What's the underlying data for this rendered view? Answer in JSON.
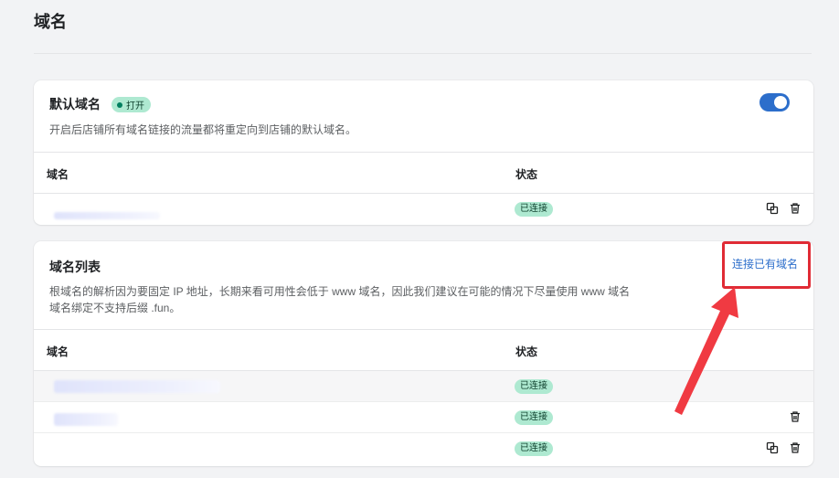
{
  "page": {
    "title": "域名"
  },
  "default_domain": {
    "title": "默认域名",
    "badge": "打开",
    "description": "开启后店铺所有域名链接的流量都将重定向到店铺的默认域名。",
    "toggle_on": true,
    "columns": [
      "域名",
      "状态"
    ],
    "rows": [
      {
        "status": "已连接",
        "actions": [
          "copy-icon",
          "delete-icon"
        ]
      }
    ]
  },
  "domain_list": {
    "title": "域名列表",
    "connect_link": "连接已有域名",
    "description_line1": "根域名的解析因为要固定 IP 地址，长期来看可用性会低于 www 域名，因此我们建议在可能的情况下尽量使用 www 域名",
    "description_line2": "域名绑定不支持后缀 .fun。",
    "columns": [
      "域名",
      "状态"
    ],
    "rows": [
      {
        "status": "已连接",
        "actions": []
      },
      {
        "status": "已连接",
        "actions": [
          "delete-icon"
        ]
      },
      {
        "status": "已连接",
        "actions": [
          "copy-icon",
          "delete-icon"
        ]
      }
    ]
  },
  "colors": {
    "accent": "#2c6ecb",
    "status_bg": "#aee9d1",
    "highlight": "#e02b35"
  }
}
